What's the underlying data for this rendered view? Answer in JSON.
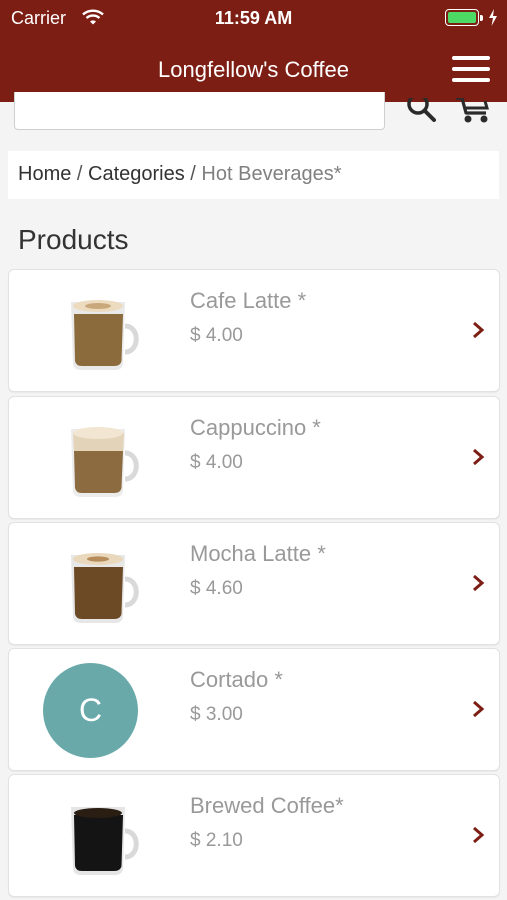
{
  "status": {
    "carrier": "Carrier",
    "time": "11:59 AM"
  },
  "nav": {
    "title": "Longfellow's Coffee"
  },
  "search": {
    "placeholder": ""
  },
  "breadcrumb": {
    "home": "Home",
    "sep": " / ",
    "categories": "Categories",
    "current": "Hot Beverages*"
  },
  "products_title": "Products",
  "products": [
    {
      "name": "Cafe Latte *",
      "price": "$ 4.00",
      "image": "latte-mug"
    },
    {
      "name": "Cappuccino *",
      "price": "$ 4.00",
      "image": "cappuccino-mug"
    },
    {
      "name": "Mocha Latte *",
      "price": "$ 4.60",
      "image": "mocha-mug"
    },
    {
      "name": "Cortado *",
      "price": "$ 3.00",
      "avatar_letter": "C",
      "avatar_color": "#6aa9aa"
    },
    {
      "name": "Brewed Coffee*",
      "price": "$ 2.10",
      "image": "black-coffee-mug"
    }
  ],
  "colors": {
    "brand": "#7d1e14",
    "battery": "#4cd964"
  }
}
